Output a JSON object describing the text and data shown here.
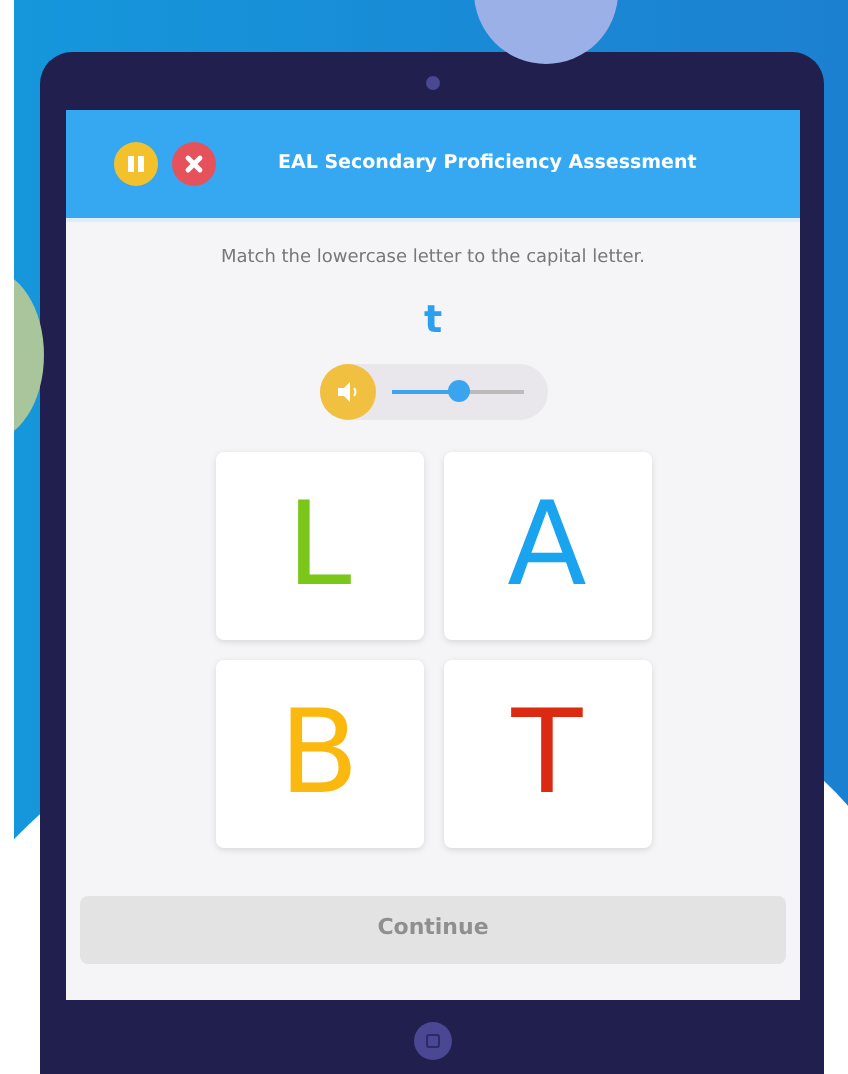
{
  "header": {
    "title": "EAL Secondary Proficiency Assessment"
  },
  "instruction": "Match the lowercase letter to the capital letter.",
  "prompt_letter": "t",
  "volume": {
    "level": 0.5
  },
  "choices": [
    {
      "label": "L",
      "color": "#7ac619",
      "selected": false
    },
    {
      "label": "A",
      "color": "#1aa3ef",
      "selected": false
    },
    {
      "label": "B",
      "color": "#fbb90f",
      "selected": false
    },
    {
      "label": "T",
      "color": "#dc2a12",
      "selected": false
    }
  ],
  "continue_button": {
    "label": "Continue",
    "disabled": true
  }
}
